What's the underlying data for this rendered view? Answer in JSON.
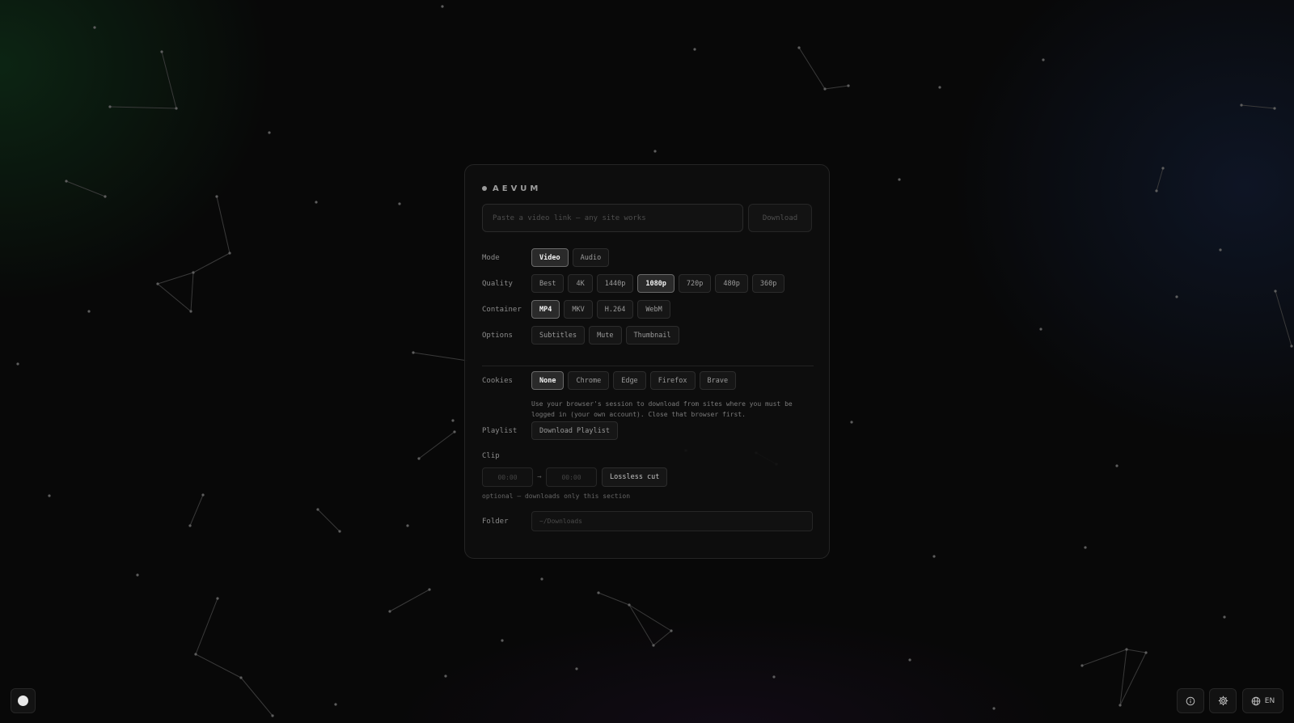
{
  "brand": {
    "name": "AEVUM"
  },
  "url": {
    "placeholder": "Paste a video link — any site works",
    "value": ""
  },
  "download_button": {
    "label": "Download"
  },
  "mode": {
    "label": "Mode",
    "options": [
      "Video",
      "Audio"
    ],
    "selected": "Video"
  },
  "quality": {
    "label": "Quality",
    "options": [
      "Best",
      "4K",
      "1440p",
      "1080p",
      "720p",
      "480p",
      "360p"
    ],
    "selected": "1080p"
  },
  "container": {
    "label": "Container",
    "options": [
      "MP4",
      "MKV",
      "H.264",
      "WebM"
    ],
    "selected": "MP4"
  },
  "options": {
    "label": "Options",
    "items": [
      "Subtitles",
      "Mute",
      "Thumbnail"
    ]
  },
  "cookies": {
    "label": "Cookies",
    "options": [
      "None",
      "Chrome",
      "Edge",
      "Firefox",
      "Brave"
    ],
    "selected": "None",
    "hint": "Use your browser's session to download from sites where you must be logged in (your own account). Close that browser first."
  },
  "playlist": {
    "label": "Playlist",
    "button": "Download Playlist"
  },
  "clip": {
    "label": "Clip",
    "start_placeholder": "00:00",
    "end_placeholder": "00:00",
    "arrow": "→",
    "lossless_label": "Lossless cut",
    "note": "optional — downloads only this section"
  },
  "folder": {
    "label": "Folder",
    "value": "~/Downloads"
  },
  "footer": {
    "language": "EN"
  },
  "icons": {
    "theme": "theme-toggle-icon",
    "info": "info-icon",
    "settings": "gear-icon",
    "language": "globe-icon"
  }
}
